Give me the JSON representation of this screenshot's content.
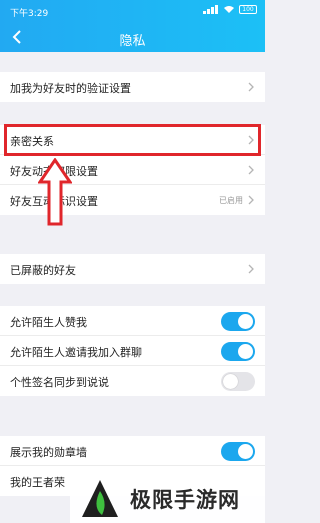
{
  "status": {
    "time": "下午3:29",
    "battery": "100"
  },
  "header": {
    "title": "隐私"
  },
  "rows": {
    "verify": "加我为好友时的验证设置",
    "intimate": "亲密关系",
    "dynamic": "好友动态权限设置",
    "interact": "好友互动标识设置",
    "interact_state": "已启用",
    "blocked": "已屏蔽的好友",
    "allow_like": "允许陌生人赞我",
    "allow_invite": "允许陌生人邀请我加入群聊",
    "signature_sync": "个性签名同步到说说",
    "medal": "展示我的勋章墙",
    "king": "我的王者荣"
  },
  "toggles": {
    "allow_like": true,
    "allow_invite": true,
    "signature_sync": false,
    "medal": true
  },
  "watermark": {
    "text": "极限手游网"
  },
  "colors": {
    "accent": "#1ba7ee",
    "highlight": "#e0262b"
  }
}
